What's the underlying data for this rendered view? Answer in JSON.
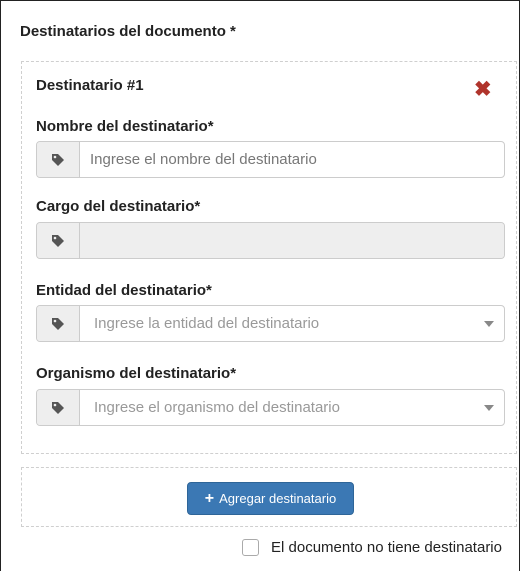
{
  "section": {
    "title": "Destinatarios del documento *"
  },
  "recipient": {
    "heading": "Destinatario #1",
    "remove_icon": "close-icon",
    "fields": {
      "name": {
        "label": "Nombre del destinatario*",
        "placeholder": "Ingrese el nombre del destinatario",
        "value": "",
        "icon": "tag-icon"
      },
      "position": {
        "label": "Cargo del destinatario*",
        "placeholder": "",
        "value": "",
        "disabled": true,
        "icon": "tag-icon"
      },
      "entity": {
        "label": "Entidad del destinatario*",
        "placeholder": "Ingrese la entidad del destinatario",
        "icon": "tag-icon"
      },
      "organism": {
        "label": "Organismo del destinatario*",
        "placeholder": "Ingrese el organismo del destinatario",
        "icon": "tag-icon"
      }
    }
  },
  "actions": {
    "add_label": "Agregar destinatario",
    "add_icon": "plus-icon"
  },
  "no_recipient": {
    "label": "El documento no tiene destinatario",
    "checked": false
  },
  "colors": {
    "primary": "#3b78b4",
    "danger": "#b0342c",
    "addon_bg": "#eeeeee",
    "border": "#cccccc"
  }
}
